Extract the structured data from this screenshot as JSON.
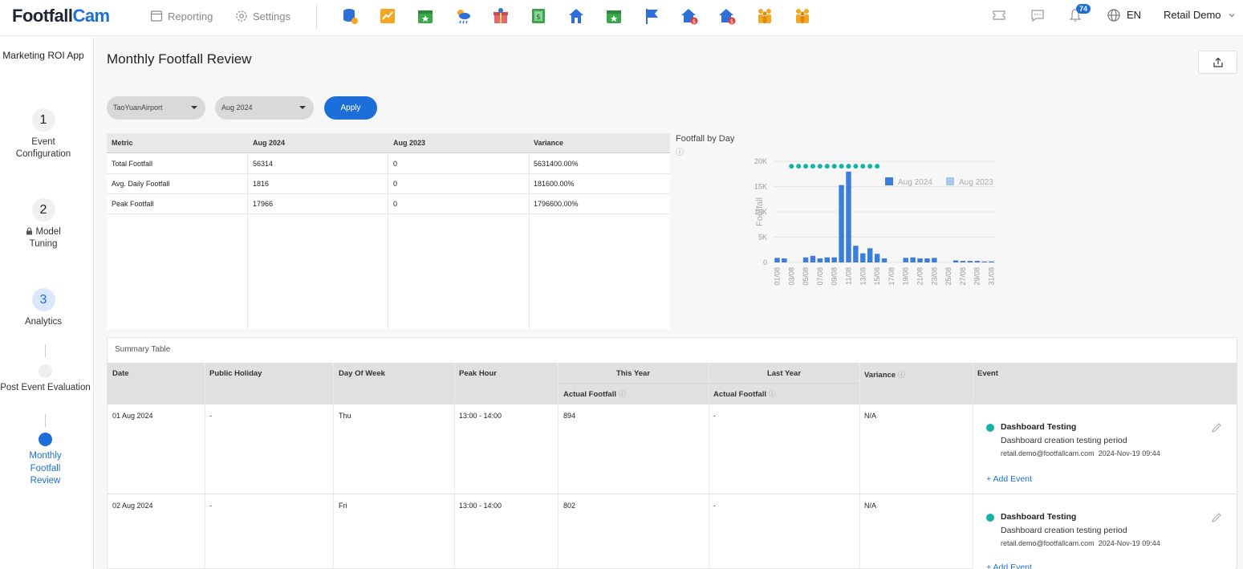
{
  "header": {
    "logo_part1": "Footfall",
    "logo_part2": "Cam",
    "nav": [
      {
        "label": "Reporting"
      },
      {
        "label": "Settings"
      }
    ],
    "notifications_count": "74",
    "language": "EN",
    "account": "Retail Demo",
    "accent": "#1c6fd8"
  },
  "sidebar": {
    "title": "Marketing ROI App",
    "steps": [
      {
        "number": "1",
        "label": "Event Configuration"
      },
      {
        "number": "2",
        "label": "Model Tuning",
        "locked": true
      },
      {
        "number": "3",
        "label": "Analytics"
      },
      {
        "label": "Post Event Evaluation"
      },
      {
        "label": "Monthly Footfall Review"
      }
    ]
  },
  "page": {
    "title": "Monthly Footfall Review",
    "filters": {
      "site": "TaoYuanAirport",
      "month": "Aug 2024",
      "apply_label": "Apply"
    }
  },
  "metrics_table": {
    "headers": [
      "Metric",
      "Aug 2024",
      "Aug 2023",
      "Variance"
    ],
    "rows": [
      [
        "Total Footfall",
        "56314",
        "0",
        "5631400.00%"
      ],
      [
        "Avg. Daily Footfall",
        "1816",
        "0",
        "181600.00%"
      ],
      [
        "Peak Footfall",
        "17966",
        "0",
        "1796600.00%"
      ]
    ]
  },
  "chart_data": {
    "type": "bar",
    "title": "Footfall by Day",
    "ylabel": "Footfall",
    "ylim": [
      0,
      20000
    ],
    "yticks": [
      "0",
      "5K",
      "10K",
      "15K",
      "20K"
    ],
    "legend": [
      {
        "name": "Aug 2024",
        "color": "#3b7ddd"
      },
      {
        "name": "Aug 2023",
        "color": "#a9c8f0"
      }
    ],
    "legend_position": "top-right",
    "categories": [
      "01/08",
      "02/08",
      "03/08",
      "04/08",
      "05/08",
      "06/08",
      "07/08",
      "08/08",
      "09/08",
      "10/08",
      "11/08",
      "12/08",
      "13/08",
      "14/08",
      "15/08",
      "16/08",
      "17/08",
      "18/08",
      "19/08",
      "20/08",
      "21/08",
      "22/08",
      "23/08",
      "24/08",
      "25/08",
      "26/08",
      "27/08",
      "28/08",
      "29/08",
      "30/08",
      "31/08"
    ],
    "xtick_labels": [
      "01/08",
      "03/08",
      "05/08",
      "07/08",
      "09/08",
      "11/08",
      "13/08",
      "15/08",
      "17/08",
      "19/08",
      "21/08",
      "23/08",
      "25/08",
      "27/08",
      "29/08",
      "31/08"
    ],
    "series": [
      {
        "name": "Aug 2024",
        "values": [
          894,
          802,
          0,
          0,
          1000,
          1300,
          800,
          1000,
          1000,
          15300,
          17966,
          3300,
          1800,
          2800,
          1700,
          800,
          0,
          0,
          900,
          1000,
          800,
          800,
          900,
          0,
          0,
          400,
          300,
          300,
          300,
          200,
          200
        ]
      }
    ],
    "markers": {
      "color": "#12b5a3",
      "value": 19500,
      "days": [
        "03/08",
        "04/08",
        "05/08",
        "06/08",
        "07/08",
        "08/08",
        "09/08",
        "10/08",
        "11/08",
        "12/08",
        "13/08",
        "14/08",
        "15/08"
      ]
    }
  },
  "summary": {
    "title": "Summary Table",
    "headers": {
      "date": "Date",
      "public_holiday": "Public Holiday",
      "day_of_week": "Day Of Week",
      "peak_hour": "Peak Hour",
      "this_year": "This Year",
      "last_year": "Last Year",
      "actual_footfall": "Actual Footfall",
      "variance": "Variance",
      "event": "Event"
    },
    "rows": [
      {
        "date": "01 Aug 2024",
        "holiday": "-",
        "dow": "Thu",
        "peak_hour": "13:00 - 14:00",
        "this_year": "894",
        "last_year": "-",
        "variance": "N/A",
        "event_name": "Dashboard Testing",
        "event_desc": "Dashboard creation testing period",
        "event_user": "retail.demo@footfallcam.com",
        "event_time": "2024-Nov-19 09:44",
        "add_event": "Add Event"
      },
      {
        "date": "02 Aug 2024",
        "holiday": "-",
        "dow": "Fri",
        "peak_hour": "13:00 - 14:00",
        "this_year": "802",
        "last_year": "-",
        "variance": "N/A",
        "event_name": "Dashboard Testing",
        "event_desc": "Dashboard creation testing period",
        "event_user": "retail.demo@footfallcam.com",
        "event_time": "2024-Nov-19 09:44",
        "add_event": "Add Event"
      }
    ]
  }
}
